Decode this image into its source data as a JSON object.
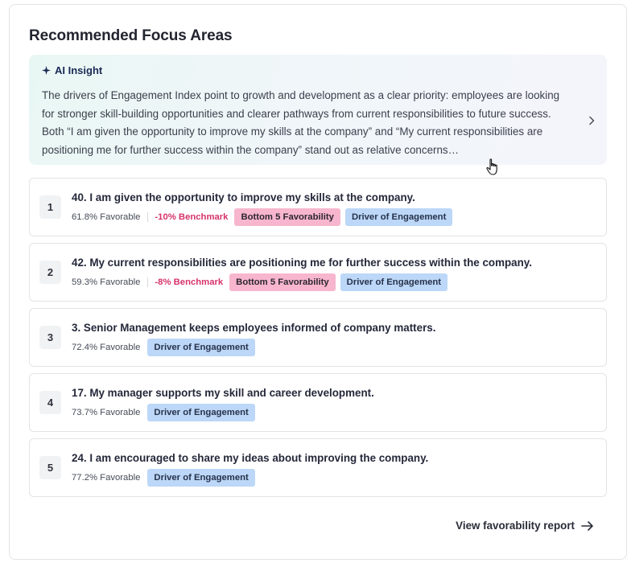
{
  "title": "Recommended Focus Areas",
  "insight": {
    "heading": "AI Insight",
    "text": "The drivers of Engagement Index point to growth and development as a clear priority: employees are looking for stronger skill-building opportunities and clearer pathways from current responsibilities to future success. Both “I am given the opportunity to improve my skills at the company” and “My current responsibilities are positioning me for further success within the company” stand out as relative concerns…",
    "sparkle_icon": "sparkle-icon",
    "chevron_icon": "chevron-right-icon"
  },
  "items": [
    {
      "rank": "1",
      "question": "40. I am given the opportunity to improve my skills at the company.",
      "favorable": "61.8% Favorable",
      "benchmark": "-10% Benchmark",
      "tags": [
        "Bottom 5 Favorability",
        "Driver of Engagement"
      ]
    },
    {
      "rank": "2",
      "question": "42. My current responsibilities are positioning me for further success within the company.",
      "favorable": "59.3% Favorable",
      "benchmark": "-8% Benchmark",
      "tags": [
        "Bottom 5 Favorability",
        "Driver of Engagement"
      ]
    },
    {
      "rank": "3",
      "question": "3. Senior Management keeps employees informed of company matters.",
      "favorable": "72.4% Favorable",
      "benchmark": "",
      "tags": [
        "Driver of Engagement"
      ]
    },
    {
      "rank": "4",
      "question": "17. My manager supports my skill and career development.",
      "favorable": "73.7% Favorable",
      "benchmark": "",
      "tags": [
        "Driver of Engagement"
      ]
    },
    {
      "rank": "5",
      "question": "24. I am encouraged to share my ideas about improving the company.",
      "favorable": "77.2% Favorable",
      "benchmark": "",
      "tags": [
        "Driver of Engagement"
      ]
    }
  ],
  "footer": {
    "link_label": "View favorability report",
    "arrow_icon": "arrow-right-icon"
  },
  "colors": {
    "benchmark": "#d6336c",
    "tag_bottom": "#f7b6cd",
    "tag_driver": "#bcd7f8",
    "insight_bg_start": "#e9f7f4",
    "insight_bg_end": "#f4f5fb"
  }
}
